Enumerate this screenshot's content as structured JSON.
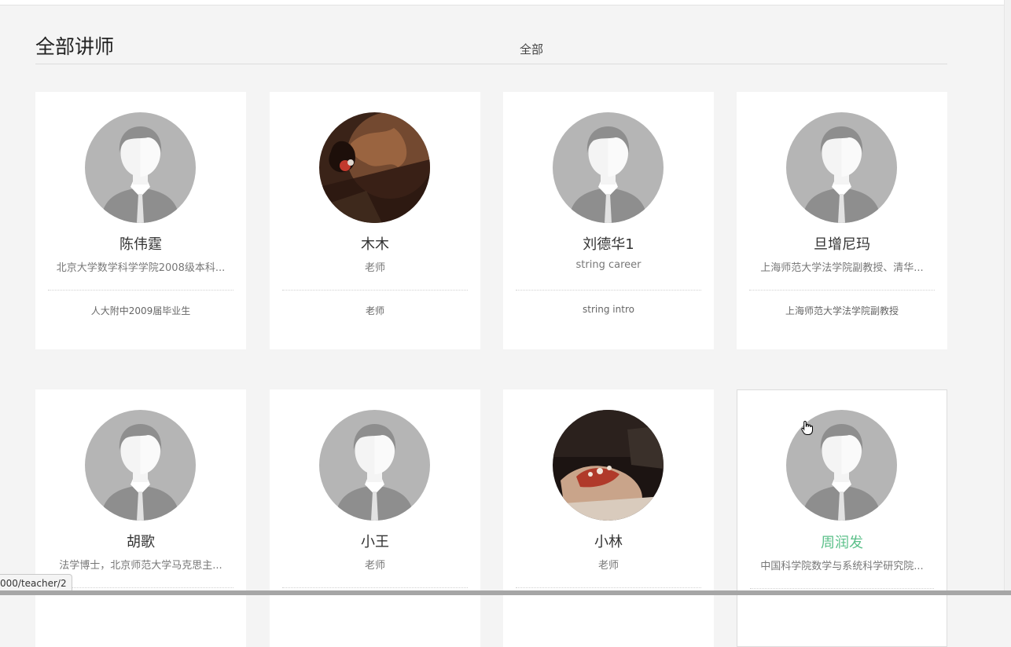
{
  "header": {
    "title": "全部讲师",
    "filter_label": "全部"
  },
  "teachers": [
    {
      "name": "陈伟霆",
      "career": "北京大学数学科学学院2008级本科...",
      "intro": "人大附中2009届毕业生",
      "avatar": "default-avatar-icon"
    },
    {
      "name": "木木",
      "career": "老师",
      "intro": "老师",
      "avatar": "photo-avatar"
    },
    {
      "name": "刘德华1",
      "career": "string career",
      "intro": "string intro",
      "avatar": "default-avatar-icon"
    },
    {
      "name": "旦增尼玛",
      "career": "上海师范大学法学院副教授、清华...",
      "intro": "上海师范大学法学院副教授",
      "avatar": "default-avatar-icon"
    },
    {
      "name": "胡歌",
      "career": "法学博士，北京师范大学马克思主...",
      "intro": "",
      "avatar": "default-avatar-icon"
    },
    {
      "name": "小王",
      "career": "老师",
      "intro": "",
      "avatar": "default-avatar-icon"
    },
    {
      "name": "小林",
      "career": "老师",
      "intro": "",
      "avatar": "photo-avatar"
    },
    {
      "name": "周润发",
      "career": "中国科学院数学与系统科学研究院...",
      "intro": "",
      "avatar": "default-avatar-icon"
    }
  ],
  "hovered_teacher_color": "#5cc08a",
  "status_bar": {
    "url": "000/teacher/2"
  }
}
